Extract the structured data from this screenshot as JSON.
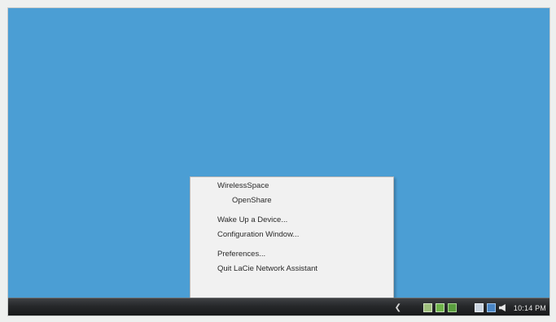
{
  "menu": {
    "items": [
      {
        "label": "WirelessSpace"
      },
      {
        "label": "OpenShare"
      },
      {
        "label": "Wake Up a Device..."
      },
      {
        "label": "Configuration Window..."
      },
      {
        "label": "Preferences..."
      },
      {
        "label": "Quit LaCie Network Assistant"
      }
    ]
  },
  "taskbar": {
    "tray_expand_icon": "chevron-left-icon",
    "clock": "10:14 PM"
  },
  "colors": {
    "desktop": "#4b9ed4",
    "taskbar": "#27292b",
    "menu_bg": "#f1f1f1"
  }
}
